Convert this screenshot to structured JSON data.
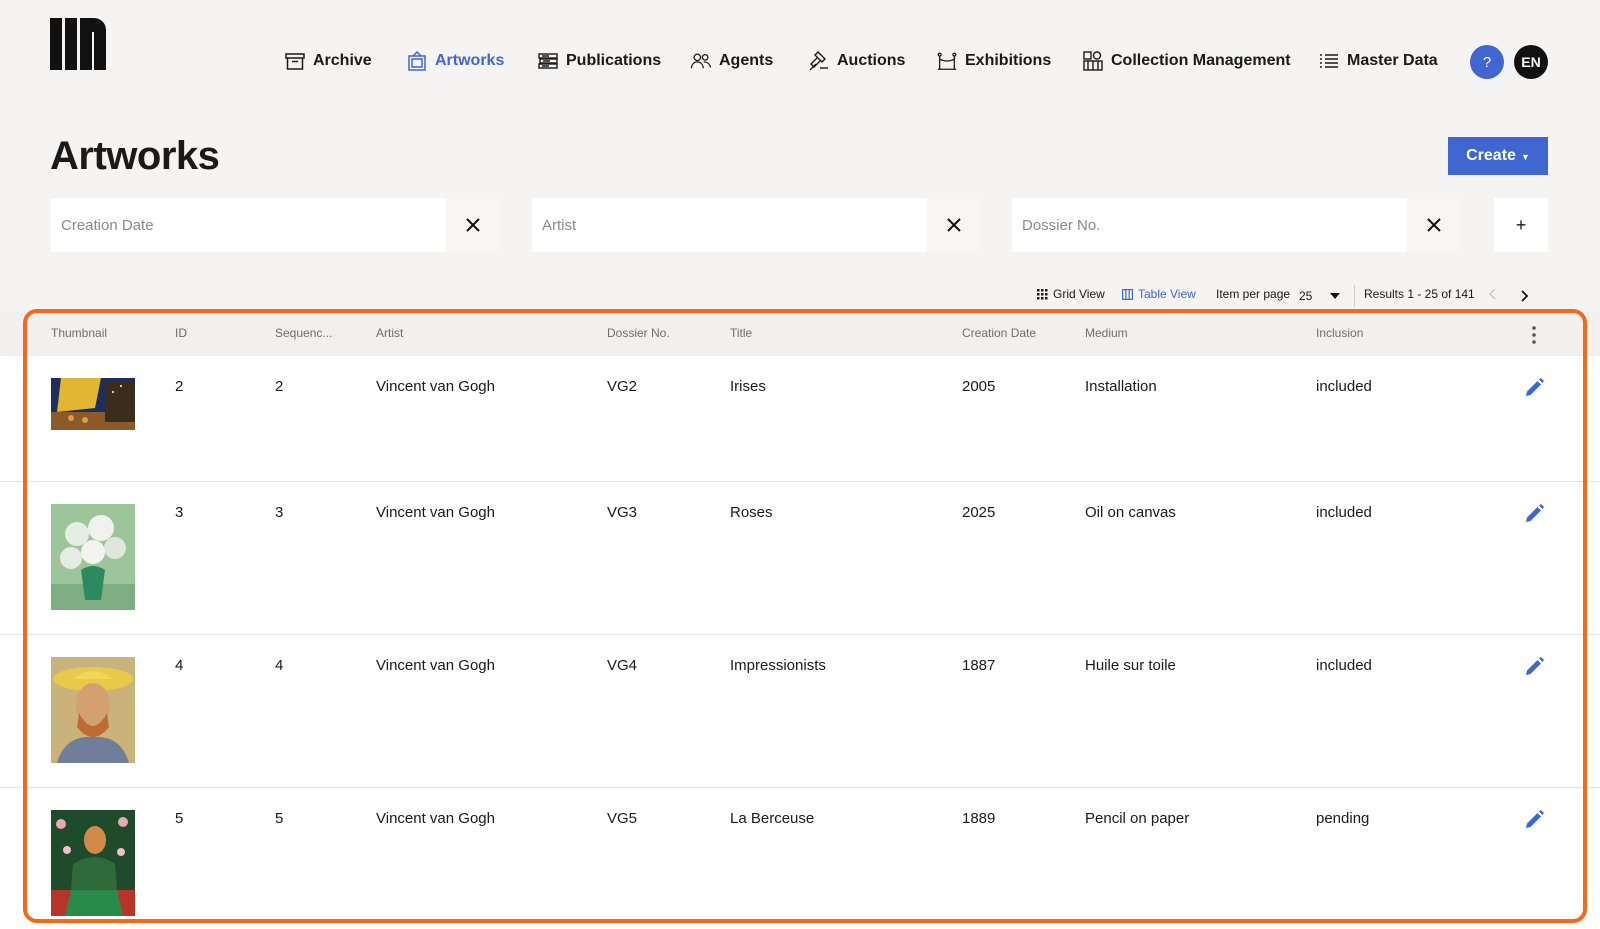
{
  "nav": {
    "items": [
      {
        "label": "Archive",
        "icon": "archive-box-icon"
      },
      {
        "label": "Artworks",
        "icon": "artwork-frame-icon",
        "active": true
      },
      {
        "label": "Publications",
        "icon": "books-icon"
      },
      {
        "label": "Agents",
        "icon": "users-icon"
      },
      {
        "label": "Auctions",
        "icon": "gavel-icon"
      },
      {
        "label": "Exhibitions",
        "icon": "exhibition-icon"
      },
      {
        "label": "Collection Management",
        "icon": "collection-icon"
      },
      {
        "label": "Master Data",
        "icon": "list-icon"
      }
    ],
    "help_label": "?",
    "lang_label": "EN"
  },
  "page": {
    "title": "Artworks",
    "create_label": "Create"
  },
  "filters": {
    "creation_date": {
      "placeholder": "Creation Date",
      "value": ""
    },
    "artist": {
      "placeholder": "Artist",
      "value": ""
    },
    "dossier": {
      "placeholder": "Dossier No.",
      "value": ""
    },
    "add_label": "+"
  },
  "toolbar": {
    "grid_view": "Grid View",
    "table_view": "Table View",
    "per_page_label": "Item per page",
    "per_page_value": "25",
    "results": "Results 1 - 25 of 141"
  },
  "table": {
    "columns": [
      "Thumbnail",
      "ID",
      "Sequenc...",
      "Artist",
      "Dossier No.",
      "Title",
      "Creation Date",
      "Medium",
      "Inclusion"
    ],
    "rows": [
      {
        "id": "2",
        "sequence": "2",
        "artist": "Vincent van Gogh",
        "dossier": "VG2",
        "title": "Irises",
        "date": "2005",
        "medium": "Installation",
        "inclusion": "included",
        "thumb": "cafe-terrace"
      },
      {
        "id": "3",
        "sequence": "3",
        "artist": "Vincent van Gogh",
        "dossier": "VG3",
        "title": "Roses",
        "date": "2025",
        "medium": "Oil on canvas",
        "inclusion": "included",
        "thumb": "roses-vase"
      },
      {
        "id": "4",
        "sequence": "4",
        "artist": "Vincent van Gogh",
        "dossier": "VG4",
        "title": "Impressionists",
        "date": "1887",
        "medium": "Huile sur toile",
        "inclusion": "included",
        "thumb": "self-portrait-straw-hat"
      },
      {
        "id": "5",
        "sequence": "5",
        "artist": "Vincent van Gogh",
        "dossier": "VG5",
        "title": "La Berceuse",
        "date": "1889",
        "medium": "Pencil on paper",
        "inclusion": "pending",
        "thumb": "la-berceuse"
      }
    ]
  },
  "colors": {
    "accent": "#3f66d1",
    "highlight": "#f26a1b",
    "background": "#f5f4f3"
  }
}
